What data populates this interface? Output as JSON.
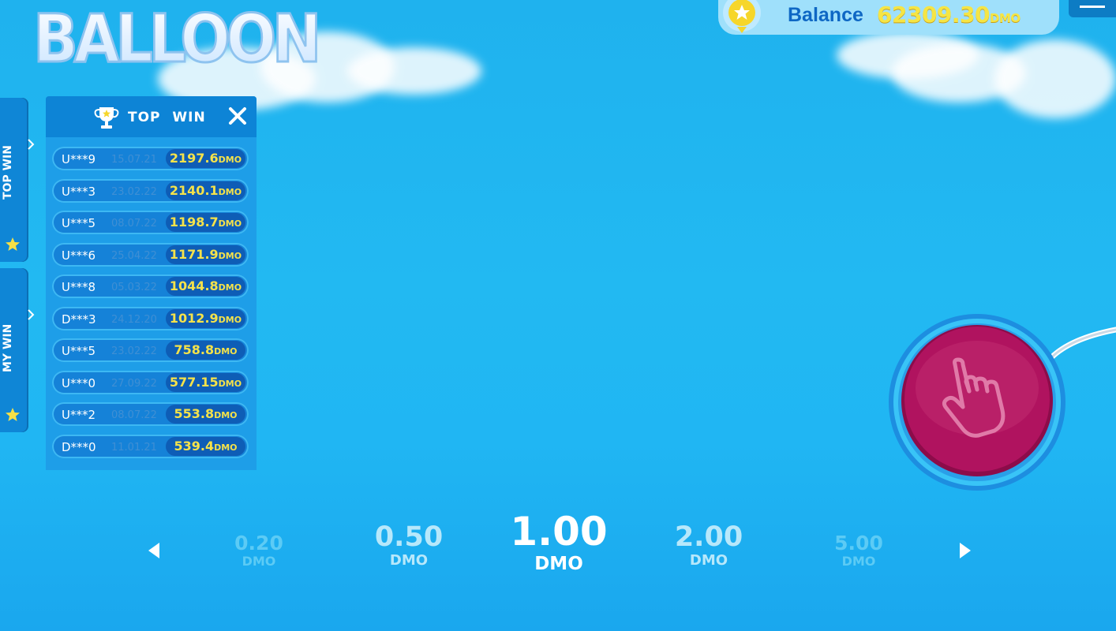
{
  "logo_text": "BALLOON",
  "balance": {
    "label": "Balance",
    "value": "62309.30",
    "unit": "DMO"
  },
  "side_tabs": [
    {
      "label": "TOP WIN",
      "icon": "star-icon"
    },
    {
      "label": "MY WIN",
      "icon": "star-icon"
    }
  ],
  "leaderboard": {
    "title": "TOP WIN",
    "rows": [
      {
        "user": "U***9",
        "date": "15.07.21",
        "amount": "2197.6",
        "unit": "DMO"
      },
      {
        "user": "U***3",
        "date": "23.02.22",
        "amount": "2140.1",
        "unit": "DMO"
      },
      {
        "user": "U***5",
        "date": "08.07.22",
        "amount": "1198.7",
        "unit": "DMO"
      },
      {
        "user": "U***6",
        "date": "25.04.22",
        "amount": "1171.9",
        "unit": "DMO"
      },
      {
        "user": "U***8",
        "date": "05.03.22",
        "amount": "1044.8",
        "unit": "DMO"
      },
      {
        "user": "D***3",
        "date": "24.12.20",
        "amount": "1012.9",
        "unit": "DMO"
      },
      {
        "user": "U***5",
        "date": "23.02.22",
        "amount": "758.8",
        "unit": "DMO"
      },
      {
        "user": "U***0",
        "date": "27.09.22",
        "amount": "577.15",
        "unit": "DMO"
      },
      {
        "user": "U***2",
        "date": "08.07.22",
        "amount": "553.8",
        "unit": "DMO"
      },
      {
        "user": "D***0",
        "date": "11.01.21",
        "amount": "539.4",
        "unit": "DMO"
      }
    ]
  },
  "bets": [
    {
      "value": "0.20",
      "unit": "DMO"
    },
    {
      "value": "0.50",
      "unit": "DMO"
    },
    {
      "value": "1.00",
      "unit": "DMO",
      "selected": true
    },
    {
      "value": "2.00",
      "unit": "DMO"
    },
    {
      "value": "5.00",
      "unit": "DMO"
    }
  ],
  "colors": {
    "sky": "#22b9f2",
    "panel": "#1e9ee8",
    "amount_text": "#f5e24a",
    "pump_button": "#b0135f"
  }
}
